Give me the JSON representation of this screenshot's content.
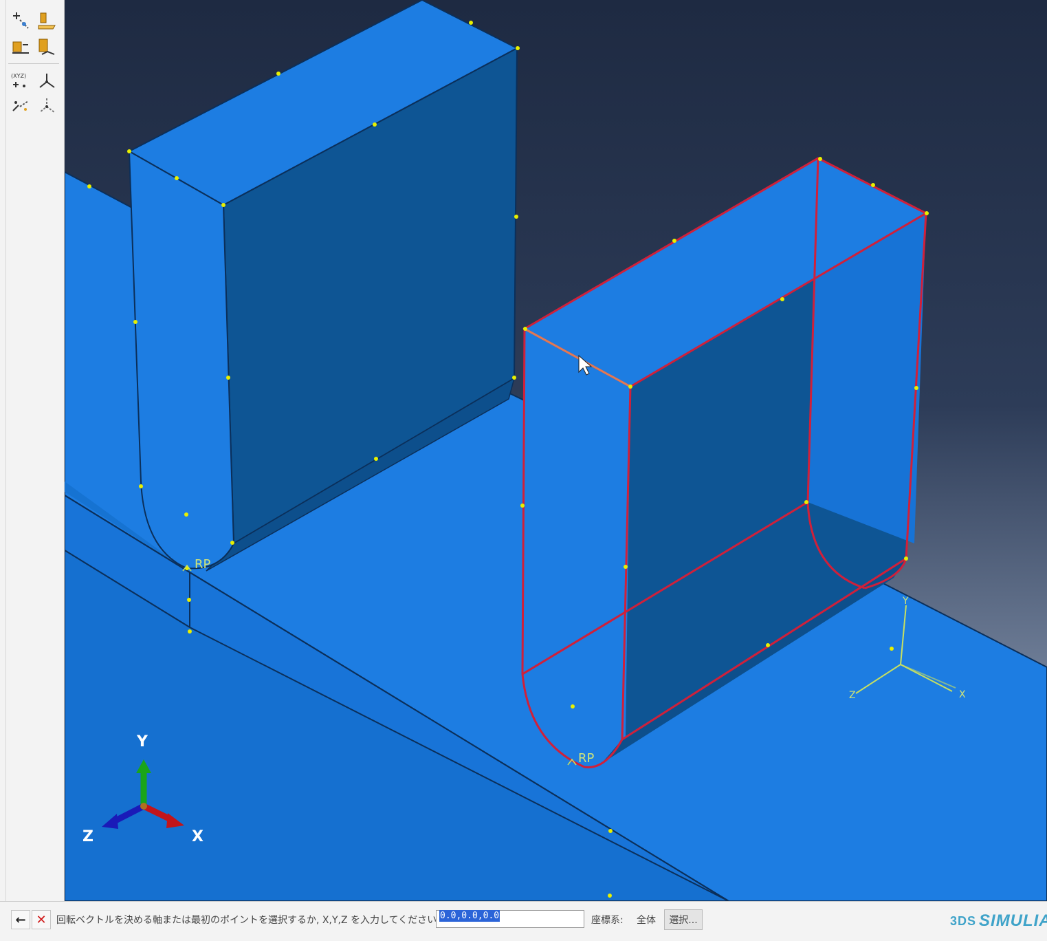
{
  "toolbar": {
    "icons": [
      "create-datum-point-icon",
      "create-datum-plane-icon",
      "create-datum-axis-icon",
      "create-datum-csys-icon",
      "xyz-datum-point-icon",
      "triad-datum-csys-icon",
      "offset-point-icon",
      "rotated-csys-icon"
    ]
  },
  "viewport": {
    "background_top": "#1e2a42",
    "background_bottom": "#a6b5cc",
    "part_color": "#1d7de2",
    "part_dark": "#0c4f8a",
    "selection_color": "#d0203a",
    "vertex_color": "#e8f000",
    "rp_labels": [
      "RP",
      "RP"
    ],
    "local_csys_labels": {
      "x": "X",
      "y": "Y",
      "z": "Z"
    },
    "global_triad_labels": {
      "x": "X",
      "y": "Y",
      "z": "Z"
    }
  },
  "prompt": {
    "back_label": "←",
    "cancel_label": "✕",
    "text": "回転ベクトルを決める軸または最初のポイントを選択するか, X,Y,Z を入力してください:",
    "input_value": "0.0,0.0,0.0",
    "csys_label": "座標系:",
    "csys_value": "全体",
    "select_button": "選択..."
  },
  "branding": {
    "logo_text": "SIMULIA",
    "logo_mark": "3DS"
  }
}
